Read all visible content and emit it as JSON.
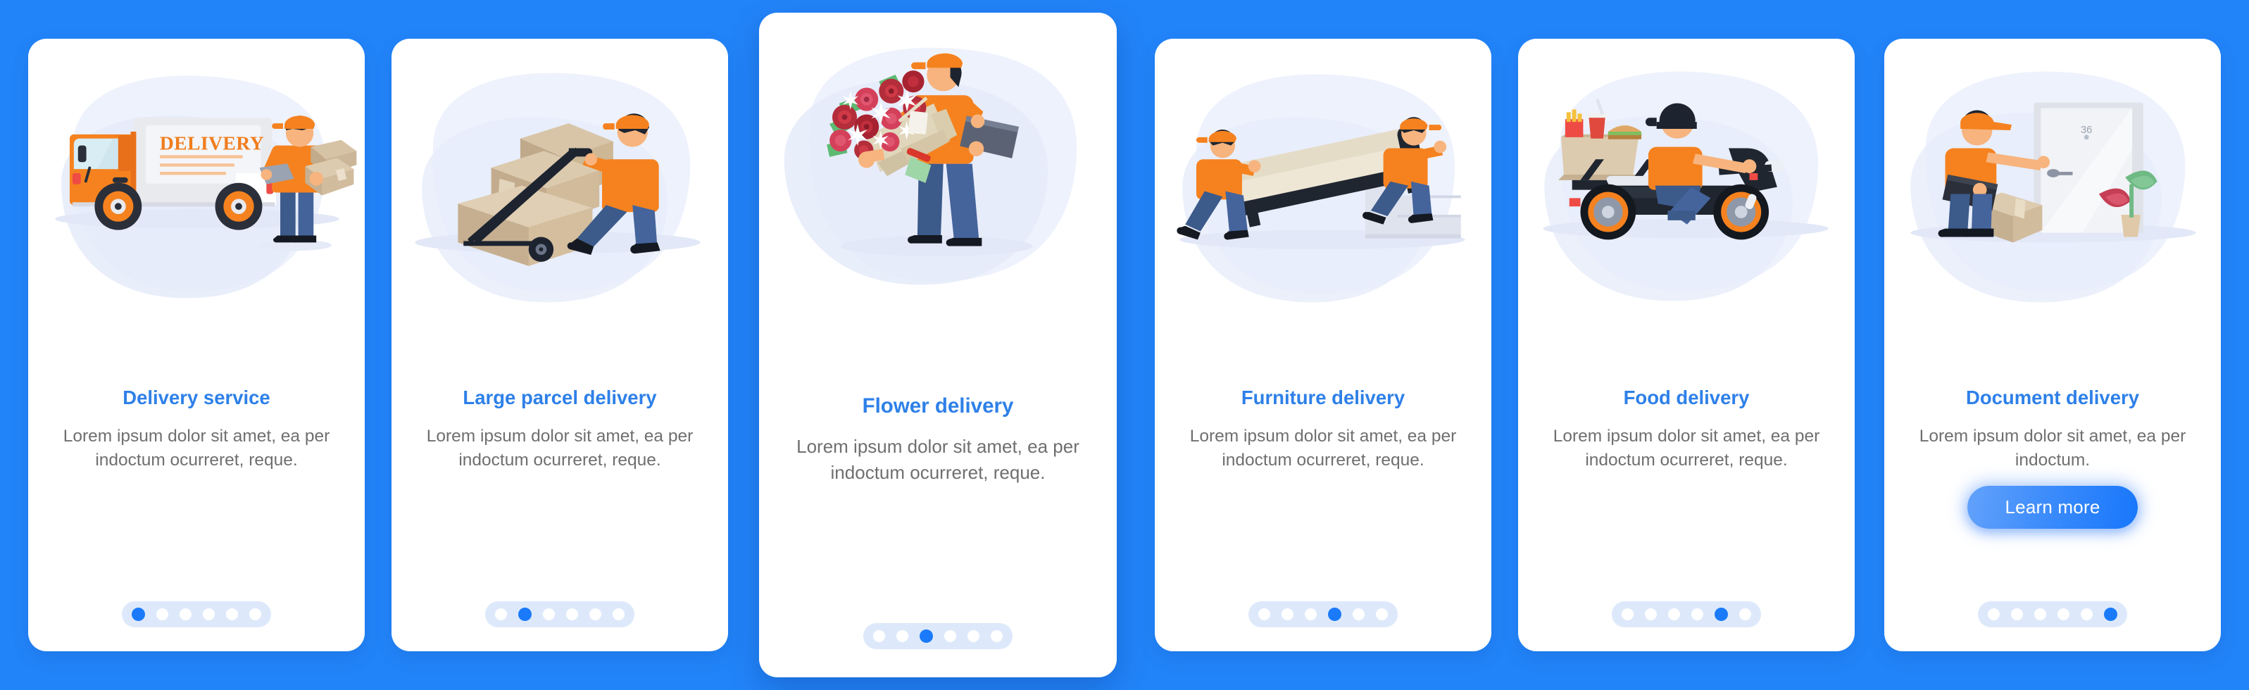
{
  "background_color": "#2284f9",
  "theme": {
    "title_color": "#2e80e8",
    "body_color": "#6f6f6f",
    "accent_blue": "#1a7afa",
    "accent_orange": "#f97c1c",
    "card_bg": "#ffffff",
    "dots_track": "#dde9fb"
  },
  "cards": [
    {
      "title": "Delivery service",
      "description": "Lorem ipsum dolor sit amet, ea per indoctum ocurreret, reque.",
      "illustration": "delivery-truck-illustration",
      "truck_label": "DELIVERY",
      "dots": {
        "count": 6,
        "active_index": 0
      },
      "featured": false,
      "cta": null
    },
    {
      "title": "Large parcel delivery",
      "description": "Lorem ipsum dolor sit amet, ea per indoctum ocurreret, reque.",
      "illustration": "hand-truck-parcels-illustration",
      "dots": {
        "count": 6,
        "active_index": 1
      },
      "featured": false,
      "cta": null
    },
    {
      "title": "Flower delivery",
      "description": "Lorem ipsum dolor sit amet, ea per indoctum ocurreret, reque.",
      "illustration": "courier-bouquet-illustration",
      "dots": {
        "count": 6,
        "active_index": 2
      },
      "featured": true,
      "cta": null
    },
    {
      "title": "Furniture delivery",
      "description": "Lorem ipsum dolor sit amet, ea per indoctum ocurreret, reque.",
      "illustration": "two-movers-sofa-stairs-illustration",
      "dots": {
        "count": 6,
        "active_index": 3
      },
      "featured": false,
      "cta": null
    },
    {
      "title": "Food delivery",
      "description": "Lorem ipsum dolor sit amet, ea per indoctum ocurreret, reque.",
      "illustration": "scooter-food-courier-illustration",
      "dots": {
        "count": 6,
        "active_index": 4
      },
      "featured": false,
      "cta": null
    },
    {
      "title": "Document delivery",
      "description": "Lorem ipsum dolor sit amet, ea per indoctum.",
      "illustration": "courier-at-door-illustration",
      "door_number": "36",
      "dots": {
        "count": 6,
        "active_index": 5
      },
      "featured": false,
      "cta": {
        "label": "Learn more"
      }
    }
  ]
}
